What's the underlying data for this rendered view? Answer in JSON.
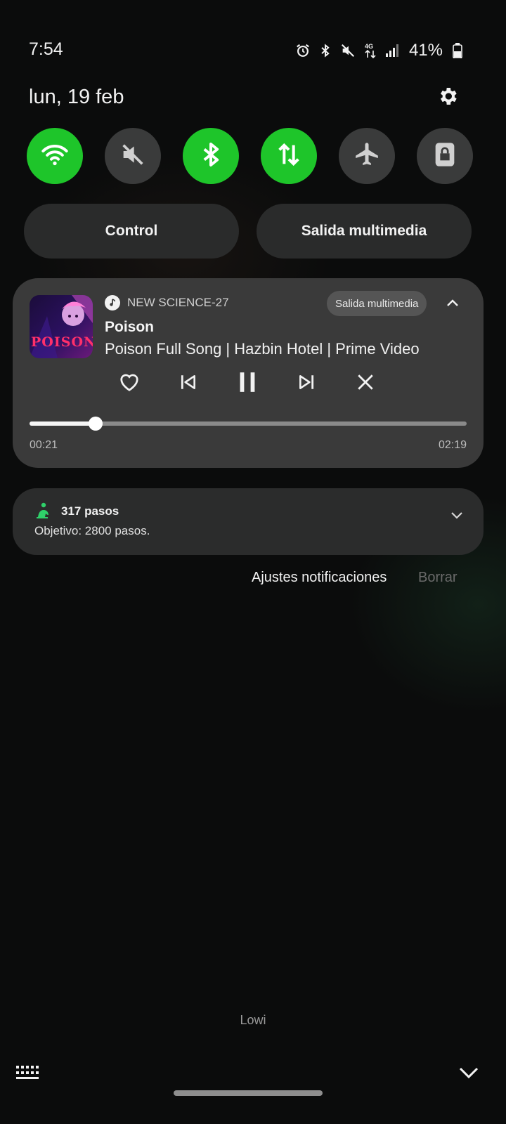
{
  "status_bar": {
    "time": "7:54",
    "battery": "41%",
    "icons": [
      "alarm-icon",
      "bluetooth-icon",
      "mute-icon",
      "4g-data-icon",
      "signal-icon",
      "battery-icon"
    ]
  },
  "header": {
    "date": "lun, 19 feb",
    "settings_icon": "gear-icon"
  },
  "quick_settings": [
    {
      "name": "wifi",
      "icon": "wifi-icon",
      "on": true
    },
    {
      "name": "sound",
      "icon": "mute-icon",
      "on": false
    },
    {
      "name": "bluetooth",
      "icon": "bluetooth-icon",
      "on": true
    },
    {
      "name": "mobile-data",
      "icon": "data-arrows-icon",
      "on": true
    },
    {
      "name": "airplane",
      "icon": "airplane-icon",
      "on": false
    },
    {
      "name": "lock",
      "icon": "lock-icon",
      "on": false
    }
  ],
  "pills": {
    "control": "Control",
    "media_output": "Salida multimedia"
  },
  "media": {
    "album_text": "POISON",
    "app_name": "NEW SCIENCE-27",
    "output_chip": "Salida multimedia",
    "title": "Poison",
    "subtitle": "Poison Full Song | Hazbin Hotel | Prime Video",
    "elapsed": "00:21",
    "duration": "02:19",
    "progress": 0.151
  },
  "steps": {
    "title": "317 pasos",
    "goal": "Objetivo: 2800 pasos."
  },
  "footer_actions": {
    "settings": "Ajustes notificaciones",
    "clear": "Borrar"
  },
  "carrier": "Lowi",
  "colors": {
    "accent_green": "#1ec52a",
    "tile_off": "#3a3b3b",
    "card": "#3a3a3a"
  }
}
